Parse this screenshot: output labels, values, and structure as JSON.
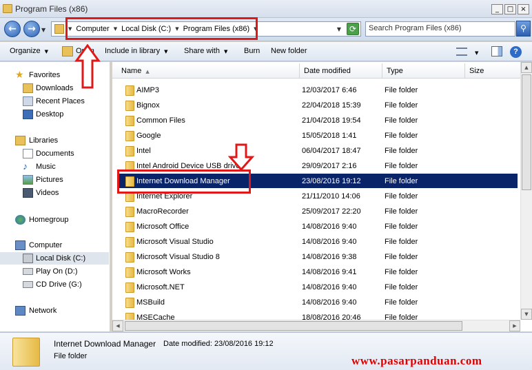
{
  "window": {
    "title": "Program Files (x86)",
    "min": "_",
    "max": "□",
    "close": "×"
  },
  "nav": {
    "back": "←",
    "forward": "→"
  },
  "address": {
    "crumbs": [
      "Computer",
      "Local Disk (C:)",
      "Program Files (x86)"
    ]
  },
  "search": {
    "placeholder": "Search Program Files (x86)"
  },
  "toolbar": {
    "organize": "Organize",
    "open": "Open",
    "include": "Include in library",
    "share": "Share with",
    "burn": "Burn",
    "new_folder": "New folder"
  },
  "sidebar": {
    "favorites": {
      "label": "Favorites",
      "items": [
        "Downloads",
        "Recent Places",
        "Desktop"
      ]
    },
    "libraries": {
      "label": "Libraries",
      "items": [
        "Documents",
        "Music",
        "Pictures",
        "Videos"
      ]
    },
    "homegroup": "Homegroup",
    "computer": {
      "label": "Computer",
      "items": [
        "Local Disk (C:)",
        "Play On (D:)",
        "CD Drive (G:)"
      ]
    },
    "network": "Network"
  },
  "columns": {
    "name": "Name",
    "date": "Date modified",
    "type": "Type",
    "size": "Size"
  },
  "files": [
    {
      "name": "AIMP3",
      "date": "12/03/2017 6:46",
      "type": "File folder"
    },
    {
      "name": "Bignox",
      "date": "22/04/2018 15:39",
      "type": "File folder"
    },
    {
      "name": "Common Files",
      "date": "21/04/2018 19:54",
      "type": "File folder"
    },
    {
      "name": "Google",
      "date": "15/05/2018 1:41",
      "type": "File folder"
    },
    {
      "name": "Intel",
      "date": "06/04/2017 18:47",
      "type": "File folder"
    },
    {
      "name": "Intel Android Device USB driver",
      "date": "29/09/2017 2:16",
      "type": "File folder"
    },
    {
      "name": "Internet Download Manager",
      "date": "23/08/2016 19:12",
      "type": "File folder"
    },
    {
      "name": "Internet Explorer",
      "date": "21/11/2010 14:06",
      "type": "File folder"
    },
    {
      "name": "MacroRecorder",
      "date": "25/09/2017 22:20",
      "type": "File folder"
    },
    {
      "name": "Microsoft Office",
      "date": "14/08/2016 9:40",
      "type": "File folder"
    },
    {
      "name": "Microsoft Visual Studio",
      "date": "14/08/2016 9:40",
      "type": "File folder"
    },
    {
      "name": "Microsoft Visual Studio 8",
      "date": "14/08/2016 9:38",
      "type": "File folder"
    },
    {
      "name": "Microsoft Works",
      "date": "14/08/2016 9:41",
      "type": "File folder"
    },
    {
      "name": "Microsoft.NET",
      "date": "14/08/2016 9:40",
      "type": "File folder"
    },
    {
      "name": "MSBuild",
      "date": "14/08/2016 9:40",
      "type": "File folder"
    },
    {
      "name": "MSECache",
      "date": "18/08/2016 20:46",
      "type": "File folder"
    }
  ],
  "details": {
    "name": "Internet Download Manager",
    "modified_label": "Date modified:",
    "modified": "23/08/2016 19:12",
    "type": "File folder"
  },
  "watermark": "www.pasarpanduan.com",
  "colors": {
    "annotation": "#e01818",
    "selection": "#0a246a",
    "watermark": "#e00000"
  }
}
